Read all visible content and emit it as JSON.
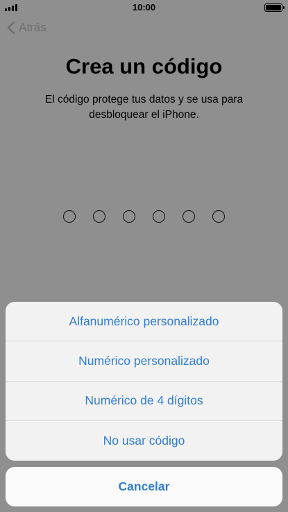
{
  "status_bar": {
    "time": "10:00",
    "signal_icon": "signal-icon",
    "battery_icon": "battery-icon"
  },
  "nav": {
    "back_label": "Atrás",
    "back_icon": "chevron-left-icon"
  },
  "header": {
    "title": "Crea un código",
    "subtitle": "El código protege tus datos y se usa para desbloquear el iPhone."
  },
  "passcode": {
    "slots": 6,
    "filled": 0
  },
  "action_sheet": {
    "options": [
      {
        "label": "Alfanumérico personalizado"
      },
      {
        "label": "Numérico personalizado"
      },
      {
        "label": "Numérico de 4 dígitos"
      },
      {
        "label": "No usar código"
      }
    ],
    "cancel_label": "Cancelar"
  },
  "colors": {
    "accent": "#2f7dd1",
    "dimmed_background": "#8f8f8f",
    "sheet_background": "#f2f2f2"
  }
}
